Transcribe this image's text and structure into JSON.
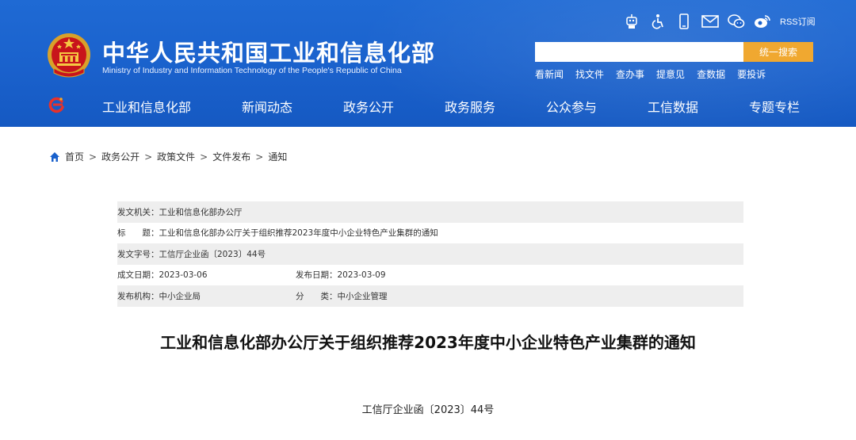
{
  "header": {
    "title": "中华人民共和国工业和信息化部",
    "subtitle": "Ministry of Industry and Information Technology of the People's Republic of China",
    "top_icons": [
      "robot-icon",
      "accessibility-icon",
      "mobile-icon",
      "mail-icon",
      "wechat-icon",
      "weibo-icon"
    ],
    "rss_label": "RSS订阅",
    "search": {
      "placeholder": "",
      "button_label": "统一搜索"
    },
    "quick_links": [
      "看新闻",
      "找文件",
      "查办事",
      "提意见",
      "查数据",
      "要投诉"
    ]
  },
  "nav": {
    "items": [
      "工业和信息化部",
      "新闻动态",
      "政务公开",
      "政务服务",
      "公众参与",
      "工信数据",
      "专题专栏"
    ]
  },
  "breadcrumb": [
    "首页",
    "政务公开",
    "政策文件",
    "文件发布",
    "通知"
  ],
  "meta": {
    "issuer": "发文机关：工业和信息化部办公厅",
    "title": "标　　题：工业和信息化部办公厅关于组织推荐2023年度中小企业特色产业集群的通知",
    "doc_no": "发文字号：工信厅企业函〔2023〕44号",
    "written_date": "成文日期：2023-03-06",
    "publish_date": "发布日期：2023-03-09",
    "publisher": "发布机构：中小企业局",
    "category": "分　　类：中小企业管理"
  },
  "document": {
    "title": "工业和信息化部办公厅关于组织推荐2023年度中小企业特色产业集群的通知",
    "number": "工信厅企业函〔2023〕44号"
  },
  "colors": {
    "header_blue": "#1a61cc",
    "search_button": "#f0a830",
    "meta_shade": "#eeeeee"
  }
}
